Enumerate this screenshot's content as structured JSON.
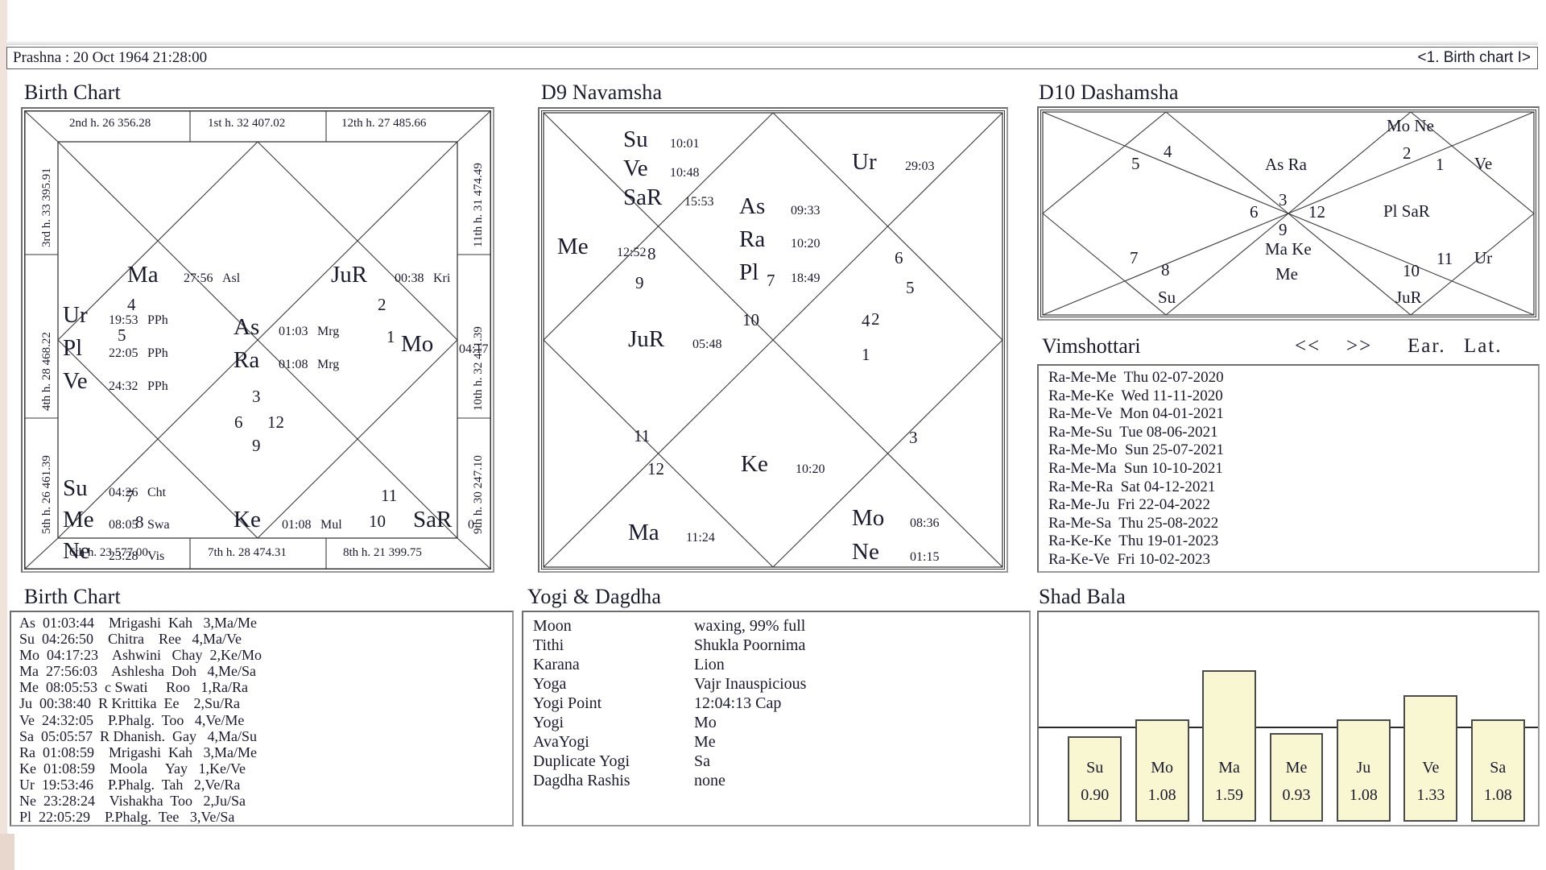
{
  "titlebar": {
    "left": "Prashna :   20 Oct 1964  21:28:00",
    "right": "<1. Birth chart I>"
  },
  "sections": {
    "birth_chart": "Birth Chart",
    "d9": "D9 Navamsha",
    "d10": "D10 Dashamsha",
    "vimshottari": "Vimshottari",
    "birth_table": "Birth Chart",
    "yogi": "Yogi & Dagdha",
    "shadbala": "Shad Bala"
  },
  "birth_chart": {
    "top_houses": [
      "2nd h.  26  356.28",
      "1st h.  32  407.02",
      "12th h.  27  485.66"
    ],
    "bottom_houses": [
      "6th h.  23  577.00",
      "7th h.  28  474.31",
      "8th h.  21  399.75"
    ],
    "left_houses": [
      "3rd h.  33  395.91",
      "4th h.  28  468.22",
      "5th h.  26  461.39"
    ],
    "right_houses": [
      "11th h.  31  474.49",
      "10th h.  32  411.39",
      "9th h.  30  247.10"
    ],
    "house_numbers": [
      "1",
      "2",
      "3",
      "4",
      "5",
      "6",
      "7",
      "8",
      "9",
      "10",
      "11",
      "12"
    ],
    "placements": [
      {
        "planet": "Ma",
        "deg": "27:56",
        "nak": "Asl"
      },
      {
        "planet": "JuR",
        "deg": "00:38",
        "nak": "Kri"
      },
      {
        "planet": "Ur",
        "deg": "19:53",
        "nak": "PPh"
      },
      {
        "planet": "Pl",
        "deg": "22:05",
        "nak": "PPh"
      },
      {
        "planet": "Ve",
        "deg": "24:32",
        "nak": "PPh"
      },
      {
        "planet": "As",
        "deg": "01:03",
        "nak": "Mrg"
      },
      {
        "planet": "Ra",
        "deg": "01:08",
        "nak": "Mrg"
      },
      {
        "planet": "Mo",
        "deg": "04:17",
        "nak": ""
      },
      {
        "planet": "Su",
        "deg": "04:26",
        "nak": "Cht"
      },
      {
        "planet": "Me",
        "deg": "08:05",
        "nak": "Swa"
      },
      {
        "planet": "Ne",
        "deg": "23:28",
        "nak": "Vis"
      },
      {
        "planet": "Ke",
        "deg": "01:08",
        "nak": "Mul"
      },
      {
        "planet": "SaR",
        "deg": "0",
        "nak": ""
      }
    ]
  },
  "d9": {
    "house_numbers": [
      "1",
      "2",
      "3",
      "4",
      "5",
      "6",
      "7",
      "8",
      "9",
      "10",
      "11",
      "12"
    ],
    "placements": [
      {
        "planet": "Su",
        "deg": "10:01"
      },
      {
        "planet": "Ve",
        "deg": "10:48"
      },
      {
        "planet": "SaR",
        "deg": "15:53"
      },
      {
        "planet": "Ur",
        "deg": "29:03"
      },
      {
        "planet": "Me",
        "deg": "12:52"
      },
      {
        "planet": "As",
        "deg": "09:33"
      },
      {
        "planet": "Ra",
        "deg": "10:20"
      },
      {
        "planet": "Pl",
        "deg": "18:49"
      },
      {
        "planet": "JuR",
        "deg": "05:48"
      },
      {
        "planet": "Ke",
        "deg": "10:20"
      },
      {
        "planet": "Ma",
        "deg": "11:24"
      },
      {
        "planet": "Mo",
        "deg": "08:36"
      },
      {
        "planet": "Ne",
        "deg": "01:15"
      }
    ]
  },
  "d10": {
    "house_numbers": [
      "1",
      "2",
      "3",
      "4",
      "5",
      "6",
      "7",
      "8",
      "9",
      "10",
      "11",
      "12"
    ],
    "placements": [
      {
        "label": "Mo Ne"
      },
      {
        "label": "Ve"
      },
      {
        "label": "As Ra"
      },
      {
        "label": "Pl SaR"
      },
      {
        "label": "Ma Ke"
      },
      {
        "label": "Me"
      },
      {
        "label": "Ur"
      },
      {
        "label": "Su"
      },
      {
        "label": "JuR"
      }
    ]
  },
  "vimshottari": {
    "nav_prev": "<<",
    "nav_next": ">>",
    "col_ear": "Ear.",
    "col_lat": "Lat.",
    "rows": [
      {
        "dasha": "Ra-Me-Me",
        "day": "Thu",
        "date": "02-07-2020"
      },
      {
        "dasha": "Ra-Me-Ke",
        "day": "Wed",
        "date": "11-11-2020"
      },
      {
        "dasha": "Ra-Me-Ve",
        "day": "Mon",
        "date": "04-01-2021"
      },
      {
        "dasha": "Ra-Me-Su",
        "day": "Tue",
        "date": "08-06-2021"
      },
      {
        "dasha": "Ra-Me-Mo",
        "day": "Sun",
        "date": "25-07-2021"
      },
      {
        "dasha": "Ra-Me-Ma",
        "day": "Sun",
        "date": "10-10-2021"
      },
      {
        "dasha": "Ra-Me-Ra",
        "day": "Sat",
        "date": "04-12-2021"
      },
      {
        "dasha": "Ra-Me-Ju",
        "day": "Fri",
        "date": "22-04-2022"
      },
      {
        "dasha": "Ra-Me-Sa",
        "day": "Thu",
        "date": "25-08-2022"
      },
      {
        "dasha": "Ra-Ke-Ke",
        "day": "Thu",
        "date": "19-01-2023"
      },
      {
        "dasha": "Ra-Ke-Ve",
        "day": "Fri",
        "date": "10-02-2023"
      }
    ]
  },
  "birth_table": {
    "rows": [
      {
        "body": "As",
        "pos": "01:03:44",
        "retro": "",
        "nak": "Mrigashi",
        "syl": "Kah",
        "pada": "3,Ma/Me"
      },
      {
        "body": "Su",
        "pos": "04:26:50",
        "retro": "",
        "nak": "Chitra",
        "syl": "Ree",
        "pada": "4,Ma/Ve"
      },
      {
        "body": "Mo",
        "pos": "04:17:23",
        "retro": "",
        "nak": "Ashwini",
        "syl": "Chay",
        "pada": "2,Ke/Mo"
      },
      {
        "body": "Ma",
        "pos": "27:56:03",
        "retro": "",
        "nak": "Ashlesha",
        "syl": "Doh",
        "pada": "4,Me/Sa"
      },
      {
        "body": "Me",
        "pos": "08:05:53",
        "retro": "c",
        "nak": "Swati",
        "syl": "Roo",
        "pada": "1,Ra/Ra"
      },
      {
        "body": "Ju",
        "pos": "00:38:40",
        "retro": "R",
        "nak": "Krittika",
        "syl": "Ee",
        "pada": "2,Su/Ra"
      },
      {
        "body": "Ve",
        "pos": "24:32:05",
        "retro": "",
        "nak": "P.Phalg.",
        "syl": "Too",
        "pada": "4,Ve/Me"
      },
      {
        "body": "Sa",
        "pos": "05:05:57",
        "retro": "R",
        "nak": "Dhanish.",
        "syl": "Gay",
        "pada": "4,Ma/Su"
      },
      {
        "body": "Ra",
        "pos": "01:08:59",
        "retro": "",
        "nak": "Mrigashi",
        "syl": "Kah",
        "pada": "3,Ma/Me"
      },
      {
        "body": "Ke",
        "pos": "01:08:59",
        "retro": "",
        "nak": "Moola",
        "syl": "Yay",
        "pada": "1,Ke/Ve"
      },
      {
        "body": "Ur",
        "pos": "19:53:46",
        "retro": "",
        "nak": "P.Phalg.",
        "syl": "Tah",
        "pada": "2,Ve/Ra"
      },
      {
        "body": "Ne",
        "pos": "23:28:24",
        "retro": "",
        "nak": "Vishakha",
        "syl": "Too",
        "pada": "2,Ju/Sa"
      },
      {
        "body": "Pl",
        "pos": "22:05:29",
        "retro": "",
        "nak": "P.Phalg.",
        "syl": "Tee",
        "pada": "3,Ve/Sa"
      }
    ]
  },
  "yogi": {
    "rows": [
      {
        "key": "Moon",
        "value": "waxing, 99% full"
      },
      {
        "key": "Tithi",
        "value": "Shukla  Poornima"
      },
      {
        "key": "Karana",
        "value": "Lion"
      },
      {
        "key": "Yoga",
        "value": "Vajr Inauspicious"
      },
      {
        "key": "Yogi Point",
        "value": "12:04:13 Cap"
      },
      {
        "key": "Yogi",
        "value": "Mo"
      },
      {
        "key": "AvaYogi",
        "value": "Me"
      },
      {
        "key": "Duplicate Yogi",
        "value": "Sa"
      },
      {
        "key": "Dagdha Rashis",
        "value": "none"
      }
    ]
  },
  "chart_data": {
    "type": "bar",
    "title": "Shad Bala",
    "categories": [
      "Su",
      "Mo",
      "Ma",
      "Me",
      "Ju",
      "Ve",
      "Sa"
    ],
    "values": [
      0.9,
      1.08,
      1.59,
      0.93,
      1.08,
      1.33,
      1.08
    ],
    "value_labels": [
      "0.90",
      "1.08",
      "1.59",
      "0.93",
      "1.08",
      "1.33",
      "1.08"
    ],
    "reference_line": 1.0,
    "ylim": [
      0,
      2.0
    ],
    "xlabel": "",
    "ylabel": "",
    "grid": false,
    "bar_fill": "#f9f7d2",
    "bar_stroke": "#4a4a4a"
  }
}
